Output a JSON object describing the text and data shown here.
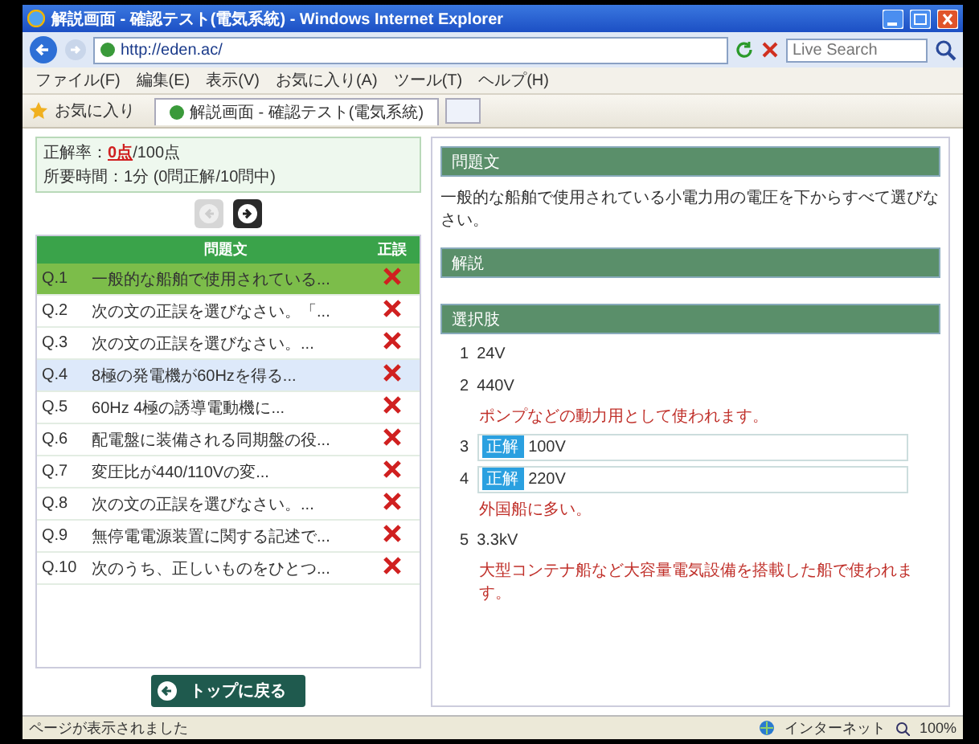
{
  "window": {
    "title": "解説画面 - 確認テスト(電気系統) - Windows Internet Explorer"
  },
  "browser": {
    "url": "http://eden.ac/",
    "search": {
      "placeholder": "Live Search"
    },
    "menu": [
      "ファイル(F)",
      "編集(E)",
      "表示(V)",
      "お気に入り(A)",
      "ツール(T)",
      "ヘルプ(H)"
    ],
    "favorites": "お気に入り",
    "tab": {
      "title": "解説画面 - 確認テスト(電気系統)"
    }
  },
  "score": {
    "label": "正解率：",
    "points": "0点",
    "total": "/100点",
    "time": "所要時間：1分 (0問正解/10問中)"
  },
  "nav": [
    {
      "kind": "prev",
      "disabled": true
    },
    {
      "kind": "next",
      "disabled": false
    }
  ],
  "table": {
    "columns": [
      "問題文",
      "正誤"
    ],
    "rows": [
      {
        "number": "Q.1",
        "text": "一般的な船舶で使用されている...",
        "selected": true,
        "highlighted": false,
        "correct": false
      },
      {
        "number": "Q.2",
        "text": "次の文の正誤を選びなさい。「...",
        "selected": false,
        "highlighted": false,
        "correct": false
      },
      {
        "number": "Q.3",
        "text": "次の文の正誤を選びなさい。...",
        "selected": false,
        "highlighted": false,
        "correct": false
      },
      {
        "number": "Q.4",
        "text": "8極の発電機が60Hzを得る...",
        "selected": false,
        "highlighted": true,
        "correct": false
      },
      {
        "number": "Q.5",
        "text": "60Hz 4極の誘導電動機に...",
        "selected": false,
        "highlighted": false,
        "correct": false
      },
      {
        "number": "Q.6",
        "text": "配電盤に装備される同期盤の役...",
        "selected": false,
        "highlighted": false,
        "correct": false
      },
      {
        "number": "Q.7",
        "text": "変圧比が440/110Vの変...",
        "selected": false,
        "highlighted": false,
        "correct": false
      },
      {
        "number": "Q.8",
        "text": "次の文の正誤を選びなさい。...",
        "selected": false,
        "highlighted": false,
        "correct": false
      },
      {
        "number": "Q.9",
        "text": "無停電電源装置に関する記述で...",
        "selected": false,
        "highlighted": false,
        "correct": false
      },
      {
        "number": "Q.10",
        "text": "次のうち、正しいものをひとつ...",
        "selected": false,
        "highlighted": false,
        "correct": false
      }
    ]
  },
  "back_button": "トップに戻る",
  "sections": [
    {
      "kind": "text",
      "title": "問題文",
      "text": "一般的な船舶で使用されている小電力用の電圧を下からすべて選びなさい。"
    },
    {
      "kind": "text",
      "title": "解説"
    },
    {
      "kind": "choices",
      "title": "選択肢",
      "choices": [
        {
          "number": "1",
          "label": "24V",
          "correct": false
        },
        {
          "number": "2",
          "label": "440V",
          "correct": false,
          "note": "ポンプなどの動力用として使われます。"
        },
        {
          "number": "3",
          "label": "100V",
          "correct": true,
          "badge": "正解"
        },
        {
          "number": "4",
          "label": "220V",
          "correct": true,
          "badge": "正解",
          "note": "外国船に多い。"
        },
        {
          "number": "5",
          "label": "3.3kV",
          "correct": false,
          "note": "大型コンテナ船など大容量電気設備を搭載した船で使われます。"
        }
      ]
    }
  ],
  "status": {
    "text": "ページが表示されました",
    "zone": "インターネット",
    "zoom": "100%"
  }
}
